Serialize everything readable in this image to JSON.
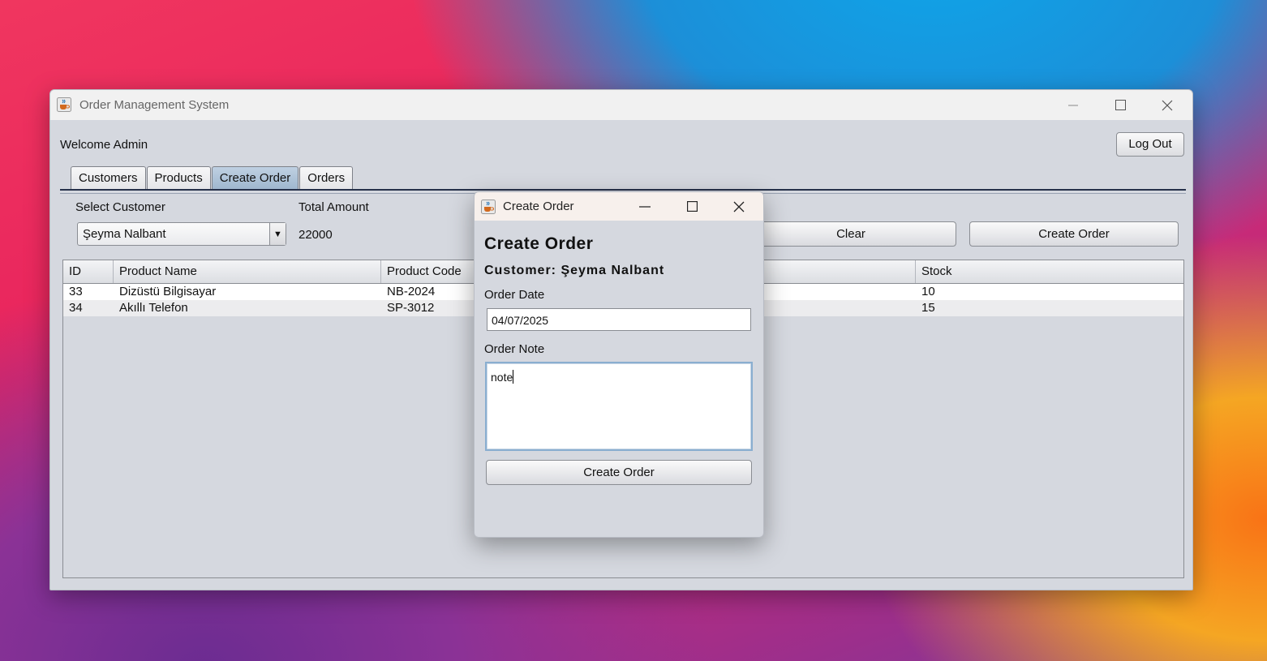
{
  "window": {
    "title": "Order Management System",
    "icon": "java-cup-icon"
  },
  "header": {
    "welcome": "Welcome Admin",
    "logout_label": "Log Out"
  },
  "tabs": [
    {
      "label": "Customers",
      "active": false
    },
    {
      "label": "Products",
      "active": false
    },
    {
      "label": "Create Order",
      "active": true
    },
    {
      "label": "Orders",
      "active": false
    }
  ],
  "create_order_panel": {
    "select_customer_label": "Select Customer",
    "selected_customer": "Şeyma Nalbant",
    "total_amount_label": "Total Amount",
    "total_amount_value": "22000",
    "clear_label": "Clear",
    "create_order_label": "Create Order"
  },
  "table": {
    "columns": [
      "ID",
      "Product Name",
      "Product Code",
      "Stock"
    ],
    "rows": [
      {
        "id": "33",
        "name": "Dizüstü Bilgisayar",
        "code": "NB-2024",
        "stock": "10"
      },
      {
        "id": "34",
        "name": "Akıllı Telefon",
        "code": "SP-3012",
        "stock": "15"
      }
    ]
  },
  "dialog": {
    "title": "Create Order",
    "heading": "Create Order",
    "customer_line": "Customer: Şeyma Nalbant",
    "order_date_label": "Order Date",
    "order_date_value": "04/07/2025",
    "order_note_label": "Order Note",
    "order_note_value": "note",
    "submit_label": "Create Order"
  },
  "colors": {
    "active_tab": "#aec3d9",
    "window_bg": "#d5d8df",
    "note_border": "#8aaed0"
  }
}
